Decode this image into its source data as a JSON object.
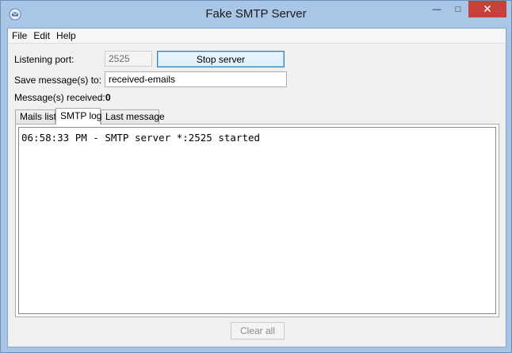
{
  "window": {
    "title": "Fake SMTP Server",
    "controls": {
      "minimize": "—",
      "maximize": "□",
      "close": "✕"
    }
  },
  "menu": {
    "items": [
      "File",
      "Edit",
      "Help"
    ]
  },
  "form": {
    "port_label": "Listening port:",
    "port_value": "2525",
    "stop_button": "Stop server",
    "save_label": "Save message(s) to:",
    "save_value": "received-emails",
    "received_label": "Message(s) received:",
    "received_count": "0"
  },
  "tabs": [
    {
      "label": "Mails list",
      "active": false
    },
    {
      "label": "SMTP log",
      "active": true
    },
    {
      "label": "Last message",
      "active": false
    }
  ],
  "log": {
    "text": "06:58:33 PM - SMTP server *:2525 started"
  },
  "footer": {
    "clear_button": "Clear all"
  },
  "colors": {
    "titlebar": "#a9c6e6",
    "close_button": "#c7413b",
    "active_button_border": "#3c7fb1"
  }
}
